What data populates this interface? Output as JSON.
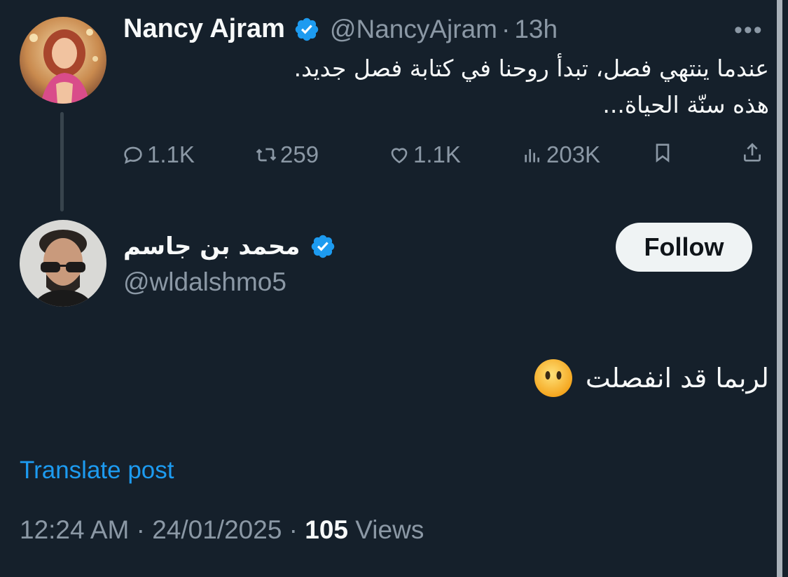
{
  "quoted_tweet": {
    "author_name": "Nancy Ajram",
    "handle": "@NancyAjram",
    "separator": "·",
    "time": "13h",
    "text_line1": "عندما ينتهي فصل، تبدأ روحنا في كتابة فصل جديد.",
    "text_line2": "هذه سنّة الحياة...",
    "stats": {
      "replies": "1.1K",
      "reposts": "259",
      "likes": "1.1K",
      "views": "203K"
    }
  },
  "reply_tweet": {
    "author_name": "محمد بن جاسم",
    "handle": "@wldalshmo5",
    "follow_label": "Follow",
    "text": "لربما قد انفصلت",
    "translate_label": "Translate post",
    "timestamp": "12:24 AM · 24/01/2025 · ",
    "views_count": "105",
    "views_label": " Views"
  },
  "colors": {
    "background": "#15202b",
    "accent": "#1d9bf0",
    "muted": "#8b98a5",
    "text": "#f7f9f9"
  },
  "icons": [
    "verified-badge-icon",
    "more-dots-icon",
    "reply-icon",
    "repost-icon",
    "like-icon",
    "views-icon",
    "bookmark-icon",
    "share-icon",
    "no-mouth-face-emoji"
  ]
}
